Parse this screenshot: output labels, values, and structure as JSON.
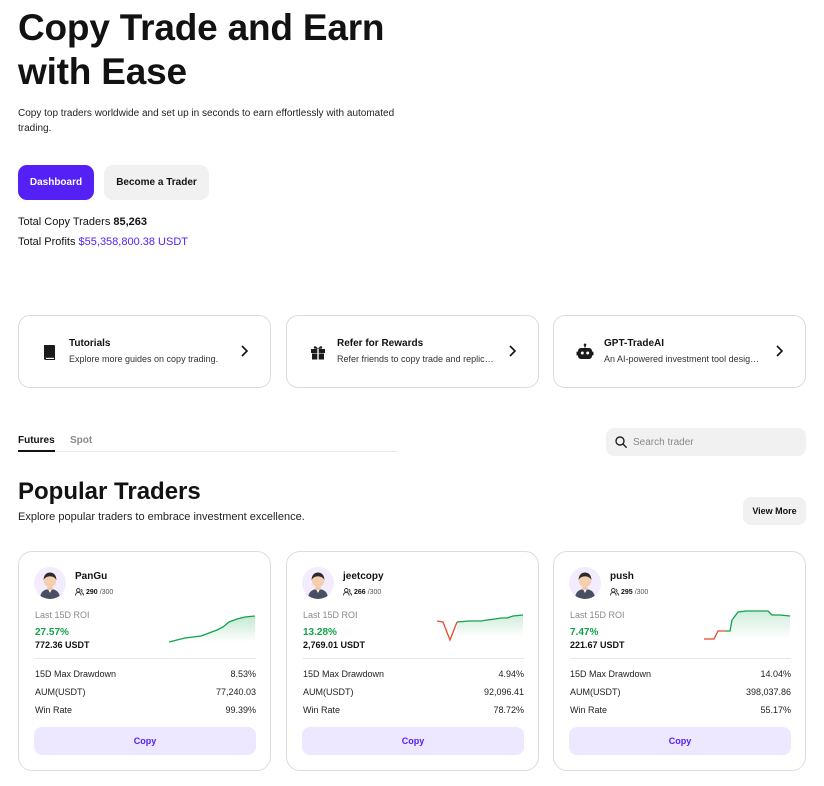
{
  "hero": {
    "title": "Copy Trade and Earn with Ease",
    "subtitle": "Copy top traders worldwide and set up in seconds to earn effortlessly with automated trading.",
    "dashboard_label": "Dashboard",
    "become_trader_label": "Become a Trader"
  },
  "stats": {
    "copy_traders_label": "Total Copy Traders",
    "copy_traders_value": "85,263",
    "profits_label": "Total Profits",
    "profits_value": "$55,358,800.38 USDT"
  },
  "features": [
    {
      "title": "Tutorials",
      "desc": "Explore more guides on copy trading.",
      "icon": "book-icon"
    },
    {
      "title": "Refer for Rewards",
      "desc": "Refer friends to copy trade and replicate their success",
      "icon": "gift-icon"
    },
    {
      "title": "GPT-TradeAI",
      "desc": "An AI-powered investment tool designed for you",
      "icon": "robot-icon"
    }
  ],
  "tabs": {
    "futures": "Futures",
    "spot": "Spot"
  },
  "search": {
    "placeholder": "Search trader"
  },
  "popular": {
    "title": "Popular Traders",
    "subtitle": "Explore popular traders to embrace investment excellence.",
    "view_more": "View More"
  },
  "labels": {
    "roi": "Last 15D ROI",
    "drawdown": "15D Max Drawdown",
    "aum": "AUM(USDT)",
    "win_rate": "Win Rate",
    "copy": "Copy"
  },
  "colors": {
    "accent": "#5420f5",
    "positive": "#12a24a",
    "negative": "#e8492b"
  },
  "traders": [
    {
      "name": "PanGu",
      "followers": "290",
      "followers_max": "/300",
      "roi": "27.57%",
      "pnl": "772.36 USDT",
      "drawdown": "8.53%",
      "aum": "77,240.03",
      "win_rate": "99.39%"
    },
    {
      "name": "jeetcopy",
      "followers": "266",
      "followers_max": "/300",
      "roi": "13.28%",
      "pnl": "2,769.01 USDT",
      "drawdown": "4.94%",
      "aum": "92,096.41",
      "win_rate": "78.72%"
    },
    {
      "name": "push",
      "followers": "295",
      "followers_max": "/300",
      "roi": "7.47%",
      "pnl": "221.67 USDT",
      "drawdown": "14.04%",
      "aum": "398,037.86",
      "win_rate": "55.17%"
    }
  ]
}
